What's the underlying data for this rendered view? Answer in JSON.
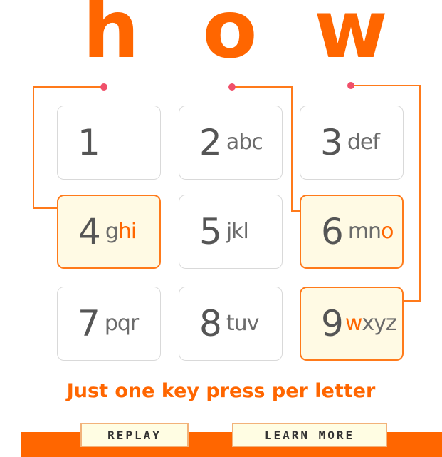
{
  "word": {
    "letters": [
      "h",
      "o",
      "w"
    ]
  },
  "keypad": {
    "keys": [
      {
        "digit": "1",
        "letters_pre": "",
        "letters_hl": "",
        "letters_post": ""
      },
      {
        "digit": "2",
        "letters_pre": "abc",
        "letters_hl": "",
        "letters_post": ""
      },
      {
        "digit": "3",
        "letters_pre": "def",
        "letters_hl": "",
        "letters_post": ""
      },
      {
        "digit": "4",
        "letters_pre": "g",
        "letters_hl": "hi",
        "letters_post": ""
      },
      {
        "digit": "5",
        "letters_pre": "jkl",
        "letters_hl": "",
        "letters_post": ""
      },
      {
        "digit": "6",
        "letters_pre": "mn",
        "letters_hl": "o",
        "letters_post": ""
      },
      {
        "digit": "7",
        "letters_pre": "pqr",
        "letters_hl": "",
        "letters_post": ""
      },
      {
        "digit": "8",
        "letters_pre": "tuv",
        "letters_hl": "",
        "letters_post": ""
      },
      {
        "digit": "9",
        "letters_pre": "",
        "letters_hl": "w",
        "letters_post": "xyz"
      }
    ]
  },
  "tagline": "Just one key press per letter",
  "buttons": {
    "replay": "REPLAY",
    "learn_more": "LEARN MORE"
  },
  "colors": {
    "accent": "#ff6600",
    "highlight_bg": "#fffae4",
    "key_border": "#d9d9d9"
  }
}
